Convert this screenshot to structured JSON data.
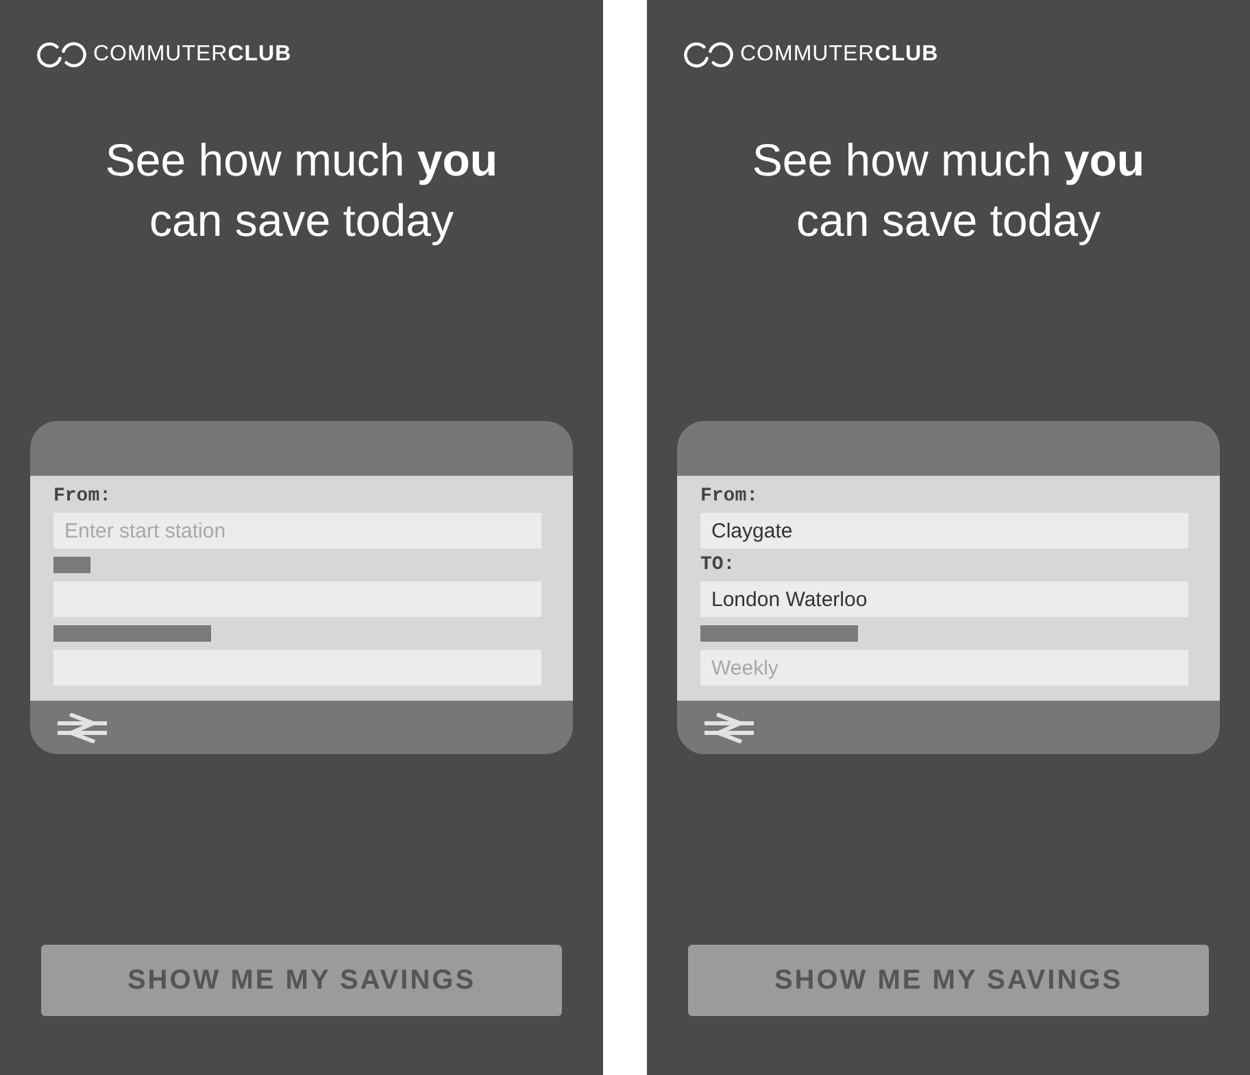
{
  "screens": [
    {
      "logo": "COMMUTER**CLUB**",
      "headline": [
        "See how much **you**",
        "can save today"
      ],
      "ticket": {
        "fields": [
          {
            "label": "From:",
            "placeholder": "Enter start station"
          },
          {
            "label_loading": true
          },
          {
            "label_loading": true
          }
        ]
      },
      "button": "SHOW ME MY SAVINGS"
    },
    {
      "logo": "COMMUTER**CLUB**",
      "headline": [
        "See how much **you**",
        "can save today"
      ],
      "ticket": {
        "fields": [
          {
            "label": "From:",
            "value": "Claygate"
          },
          {
            "label": "TO:",
            "value": "London Waterloo"
          },
          {
            "label_loading": true,
            "placeholder": "Weekly"
          }
        ]
      },
      "button": "SHOW ME MY SAVINGS"
    }
  ]
}
